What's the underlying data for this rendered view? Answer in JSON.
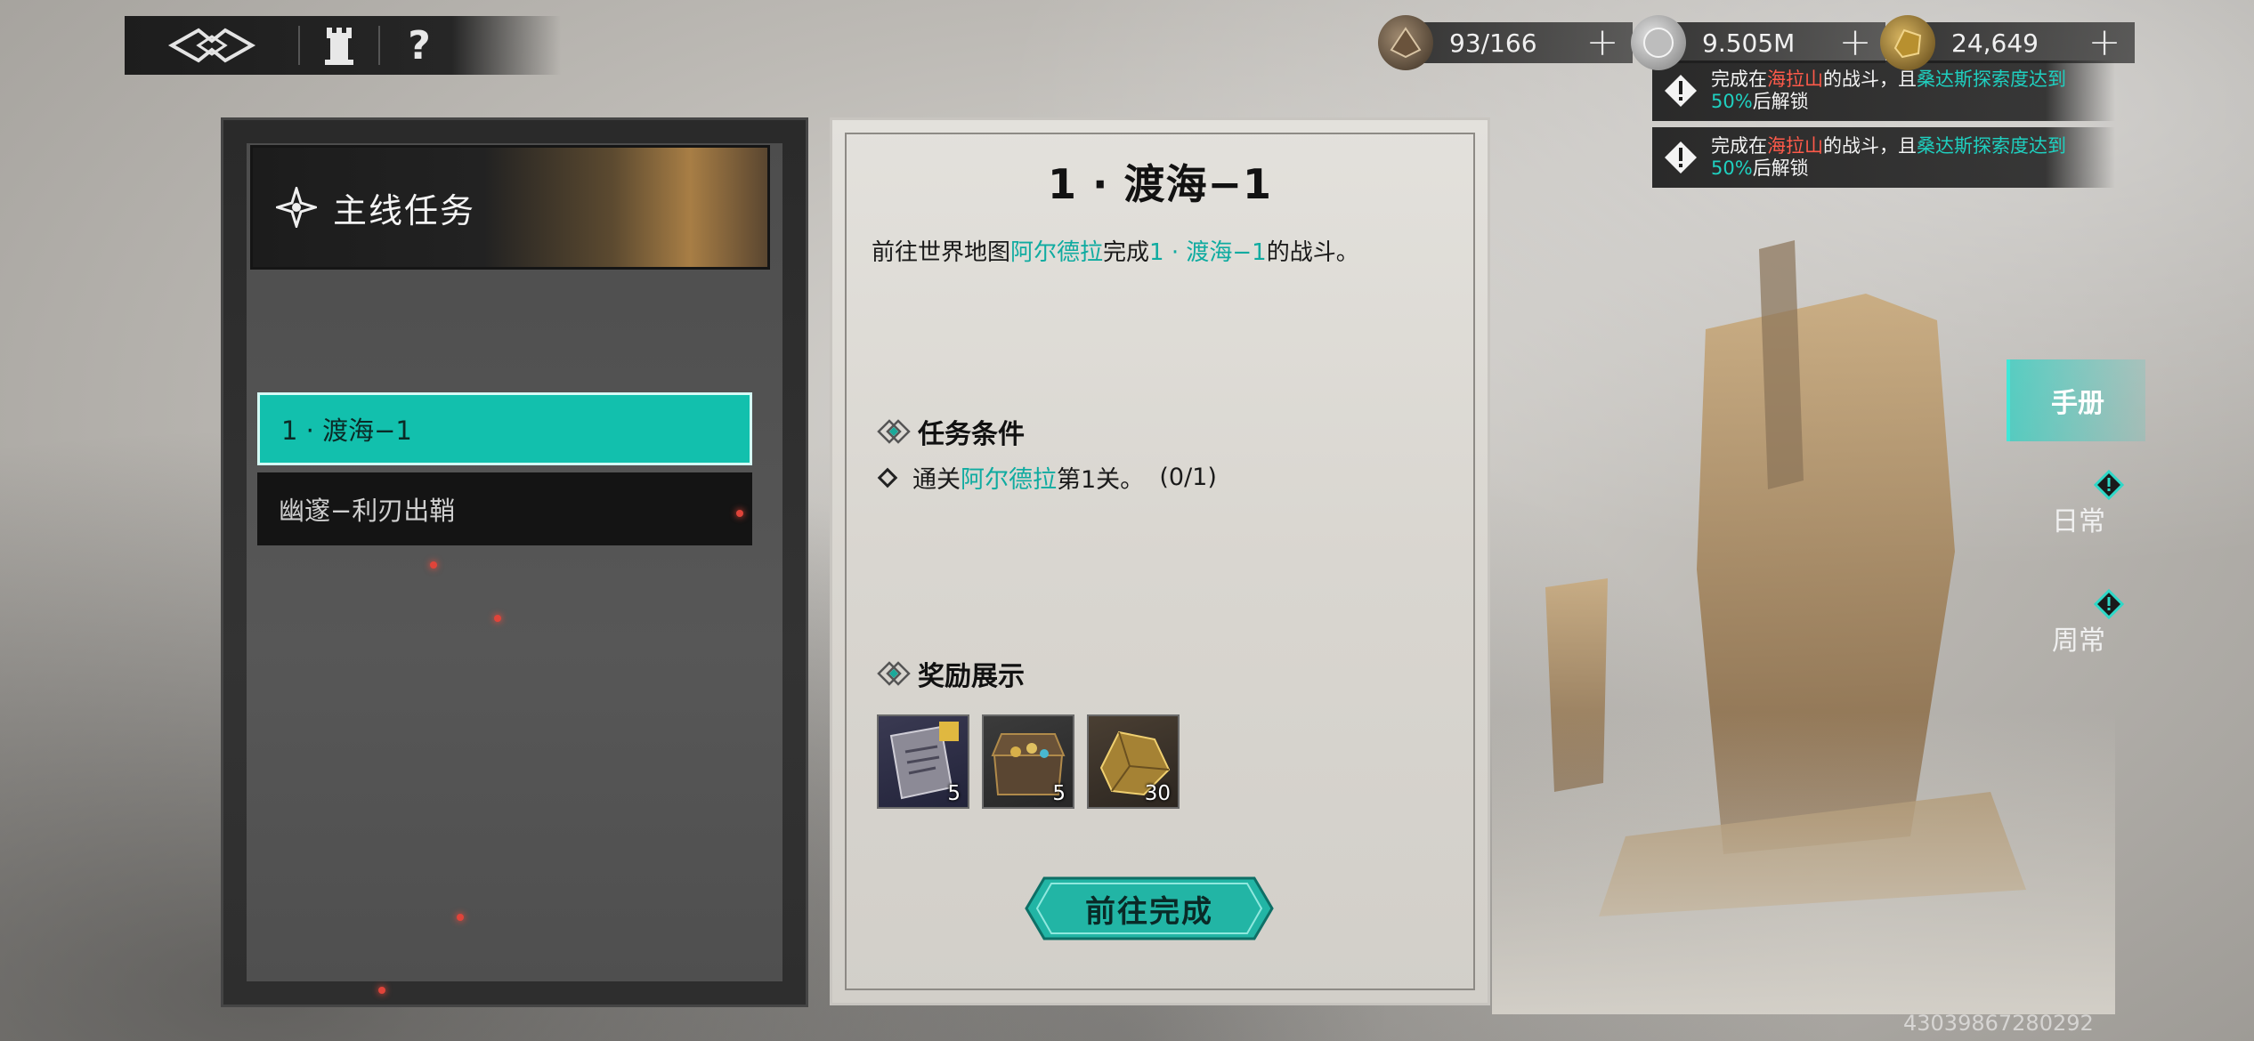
{
  "nav": {
    "help_label": "?"
  },
  "currencies": [
    {
      "icon": "stamina-icon",
      "value": "93/166",
      "plus": "+"
    },
    {
      "icon": "silver-coin-icon",
      "value": "9.505M",
      "plus": "+"
    },
    {
      "icon": "gold-ore-icon",
      "value": "24,649",
      "plus": "+"
    }
  ],
  "notices": [
    {
      "p1": "完成在",
      "place": "海拉山",
      "p2": "的战斗，且",
      "region": "桑达斯探索度达到",
      "pct": "50%",
      "p3": "后解锁"
    },
    {
      "p1": "完成在",
      "place": "海拉山",
      "p2": "的战斗，且",
      "region": "桑达斯探索度达到",
      "pct": "50%",
      "p3": "后解锁"
    }
  ],
  "left_panel": {
    "banner_title": "主线任务",
    "quests": [
      {
        "label": "1 · 渡海−1",
        "active": true
      },
      {
        "label": "幽邃−利刃出鞘",
        "active": false
      }
    ]
  },
  "detail": {
    "title": "1 · 渡海−1",
    "desc": {
      "p1": "前往世界地图",
      "map": "阿尔德拉",
      "p2": "完成",
      "stage": "1 · 渡海−1",
      "p3": "的战斗。"
    },
    "conditions_header": "任务条件",
    "condition": {
      "p1": "通关",
      "map": "阿尔德拉",
      "p2": "第1关。",
      "progress": "(0/1)"
    },
    "rewards_header": "奖励展示",
    "rewards": [
      {
        "icon": "scroll-puzzle-icon",
        "qty": "5"
      },
      {
        "icon": "treasure-chest-icon",
        "qty": "5"
      },
      {
        "icon": "gold-ore-icon",
        "qty": "30"
      }
    ],
    "go_button": "前往完成"
  },
  "tabs": {
    "handbook": "手册",
    "daily": "日常",
    "weekly": "周常"
  },
  "uid": "43039867280292",
  "colors": {
    "accent_teal": "#12c0ad",
    "notice_red": "#ff5a4a",
    "notice_teal": "#1fd0c0"
  }
}
